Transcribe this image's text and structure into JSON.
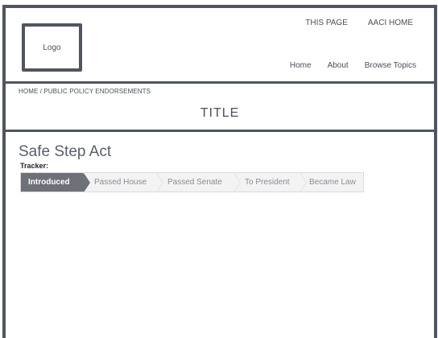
{
  "header": {
    "logo_text": "Logo",
    "util_nav": [
      "THIS PAGE",
      "AACI HOME"
    ],
    "main_nav": [
      "Home",
      "About",
      "Browse Topics"
    ]
  },
  "breadcrumb": "HOME / PUBLIC POLICY ENDORSEMENTS",
  "page_title": "TITLE",
  "act": {
    "title": "Safe Step Act",
    "tracker_label": "Tracker:",
    "steps": [
      "Introduced",
      "Passed House",
      "Passed Senate",
      "To President",
      "Became Law"
    ],
    "active_step": "Introduced"
  },
  "colors": {
    "frame": "#505561",
    "active_step": "#6e7178",
    "inactive_step": "#f3f3f4"
  }
}
